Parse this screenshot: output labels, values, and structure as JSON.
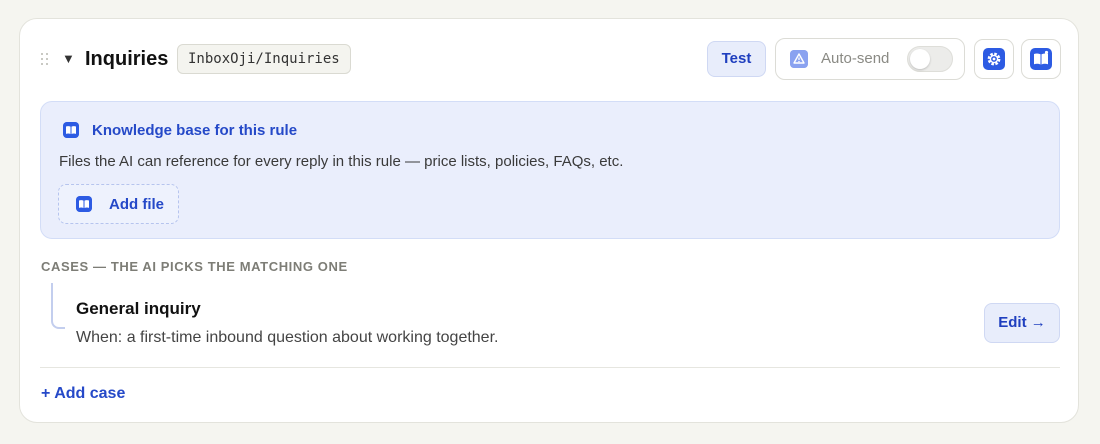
{
  "rule": {
    "title": "Inquiries",
    "folder": "InboxOji/Inquiries",
    "collapse_glyph": "▼",
    "drag_handle_icon": "drag-handle-icon"
  },
  "toolbar": {
    "test_label": "Test",
    "autosend_label": "Auto-send",
    "autosend_enabled": false,
    "autosend_icon": "warning-triangle-icon",
    "settings_icon": "gear-icon",
    "knowledge_icon": "book-icon"
  },
  "knowledge_base": {
    "title": "Knowledge base for this rule",
    "description": "Files the AI can reference for every reply in this rule — price lists, policies, FAQs, etc.",
    "add_file_label": "Add file",
    "icon": "book-icon"
  },
  "cases": {
    "heading": "CASES — THE AI PICKS THE MATCHING ONE",
    "items": [
      {
        "title": "General inquiry",
        "when": "When: a first-time inbound question about working together.",
        "edit_label": "Edit →"
      }
    ],
    "add_label": "+ Add case"
  },
  "colors": {
    "accent": "#2549c8",
    "accent_bg": "#e8edfb",
    "panel_bg": "#eaeefc",
    "page_bg": "#f5f5f0"
  }
}
